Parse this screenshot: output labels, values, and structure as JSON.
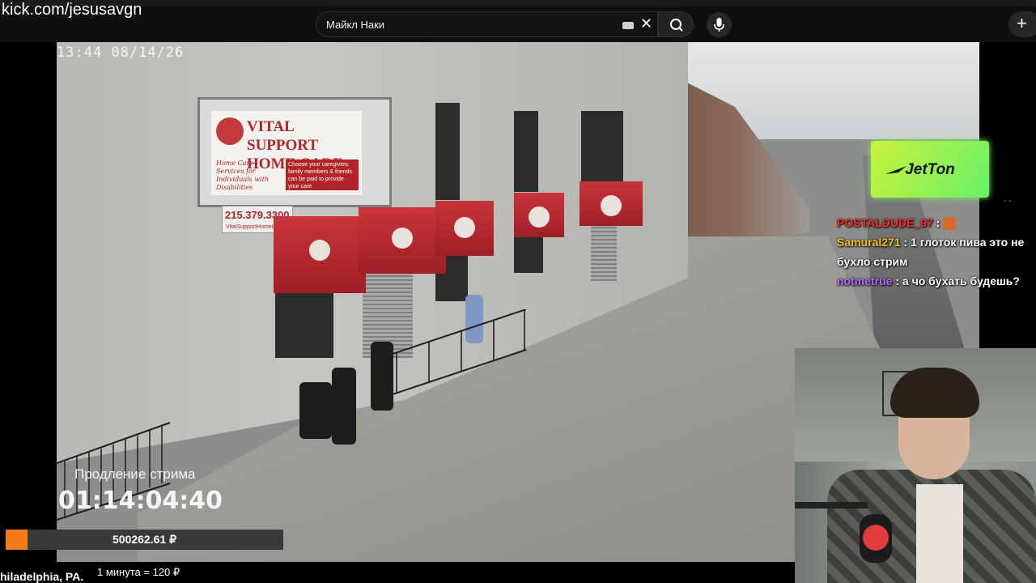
{
  "browser": {
    "url": "kick.com/jesusavgn",
    "search_value": "Майкл Наки"
  },
  "icons": {
    "keyboard": "keyboard-icon",
    "clear": "close-icon",
    "search": "search-icon",
    "mic": "microphone-icon",
    "create": "plus-icon"
  },
  "glyphs": {
    "clear": "✕",
    "plus": "+"
  },
  "camera": {
    "timestamp": "13:44 08/14/26",
    "sign_title": "VITAL SUPPORT HOME CARE",
    "sign_script": "Home Care Services for Individuals with Disabilities",
    "sign_note": "Choose your caregivers: family members & friends can be paid to provide your care",
    "phone": "215.379.3300",
    "website": "VitalSupportHomeCare.com"
  },
  "overlay": {
    "extension_label": "Продление стрима",
    "timer": "01:14:04:40",
    "donation_amount": "500262.61 ₽",
    "donation_progress": 0.08,
    "location": "hiladelphia, PA.",
    "rate": "1 минута = 120 ₽",
    "accent": "#f57b16"
  },
  "sponsor": {
    "name": "JetTon",
    "dots": "- -"
  },
  "chat": [
    {
      "user": "POSTALDUDE_97",
      "text": ""
    },
    {
      "user": "Samural271",
      "text": "1 глоток пива это не бухло стрим"
    },
    {
      "user": "notmetrue",
      "text": "а чо бухать будешь?"
    }
  ]
}
